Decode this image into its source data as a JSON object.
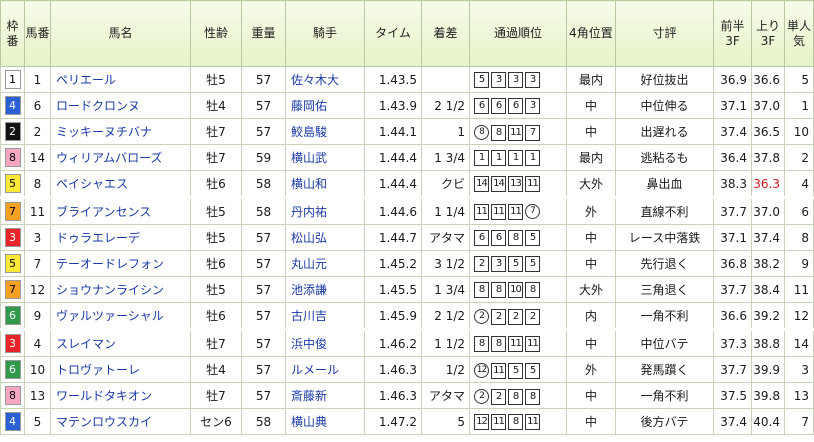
{
  "headers": {
    "waku": "枠番",
    "umaban": "馬番",
    "name": "馬名",
    "sexage": "性齢",
    "weight": "重量",
    "jockey": "騎手",
    "time": "タイム",
    "margin": "着差",
    "passing": "通過順位",
    "corner": "4角位置",
    "comment": "寸評",
    "first3f": "前半3F",
    "last3f": "上り3F",
    "odds": "単人気"
  },
  "waku_colors": {
    "1": {
      "bg": "#ffffff",
      "fg": "#000000"
    },
    "2": {
      "bg": "#111111",
      "fg": "#ffffff"
    },
    "3": {
      "bg": "#e8262a",
      "fg": "#ffffff"
    },
    "4": {
      "bg": "#2a5fd6",
      "fg": "#ffffff"
    },
    "5": {
      "bg": "#ffe838",
      "fg": "#000000"
    },
    "6": {
      "bg": "#2e9a4a",
      "fg": "#ffffff"
    },
    "7": {
      "bg": "#f5a023",
      "fg": "#000000"
    },
    "8": {
      "bg": "#f7a7c4",
      "fg": "#000000"
    }
  },
  "rows": [
    {
      "waku": "1",
      "umaban": "1",
      "name": "ペリエール",
      "sexage": "牡5",
      "weight": "57",
      "jockey": "佐々木大",
      "time": "1.43.5",
      "margin": "",
      "passing": [
        {
          "v": "5",
          "s": "box"
        },
        {
          "v": "3",
          "s": "box"
        },
        {
          "v": "3",
          "s": "box"
        },
        {
          "v": "3",
          "s": "box"
        }
      ],
      "corner": "最内",
      "comment": "好位抜出",
      "f3": "36.9",
      "l3": "36.6",
      "odds": "5",
      "l3_red": false
    },
    {
      "waku": "4",
      "umaban": "6",
      "name": "ロードクロンヌ",
      "sexage": "牡4",
      "weight": "57",
      "jockey": "藤岡佑",
      "time": "1.43.9",
      "margin": "2 1/2",
      "passing": [
        {
          "v": "6",
          "s": "box"
        },
        {
          "v": "6",
          "s": "box"
        },
        {
          "v": "6",
          "s": "box"
        },
        {
          "v": "3",
          "s": "box"
        }
      ],
      "corner": "中",
      "comment": "中位伸る",
      "f3": "37.1",
      "l3": "37.0",
      "odds": "1",
      "l3_red": false
    },
    {
      "waku": "2",
      "umaban": "2",
      "name": "ミッキーヌチバナ",
      "sexage": "牡7",
      "weight": "57",
      "jockey": "鮫島駿",
      "time": "1.44.1",
      "margin": "1",
      "passing": [
        {
          "v": "8",
          "s": "circ"
        },
        {
          "v": "8",
          "s": "box"
        },
        {
          "v": "11",
          "s": "box"
        },
        {
          "v": "7",
          "s": "box"
        }
      ],
      "corner": "中",
      "comment": "出遅れる",
      "f3": "37.4",
      "l3": "36.5",
      "odds": "10",
      "l3_red": false
    },
    {
      "waku": "8",
      "umaban": "14",
      "name": "ウィリアムバローズ",
      "sexage": "牡7",
      "weight": "59",
      "jockey": "横山武",
      "time": "1.44.4",
      "margin": "1 3/4",
      "passing": [
        {
          "v": "1",
          "s": "box"
        },
        {
          "v": "1",
          "s": "box"
        },
        {
          "v": "1",
          "s": "box"
        },
        {
          "v": "1",
          "s": "box"
        }
      ],
      "corner": "最内",
      "comment": "逃粘るも",
      "f3": "36.4",
      "l3": "37.8",
      "odds": "2",
      "l3_red": false
    },
    {
      "waku": "5",
      "umaban": "8",
      "name": "ペイシャエス",
      "sexage": "牡6",
      "weight": "58",
      "jockey": "横山和",
      "time": "1.44.4",
      "margin": "クビ",
      "passing": [
        {
          "v": "14",
          "s": "box"
        },
        {
          "v": "14",
          "s": "box"
        },
        {
          "v": "13",
          "s": "box"
        },
        {
          "v": "11",
          "s": "box"
        }
      ],
      "corner": "大外",
      "comment": "鼻出血",
      "f3": "38.3",
      "l3": "36.3",
      "odds": "4",
      "l3_red": true
    },
    {
      "waku": "7",
      "umaban": "11",
      "name": "ブライアンセンス",
      "sexage": "牡5",
      "weight": "58",
      "jockey": "丹内祐",
      "time": "1.44.6",
      "margin": "1 1/4",
      "passing": [
        {
          "v": "11",
          "s": "box"
        },
        {
          "v": "11",
          "s": "box"
        },
        {
          "v": "11",
          "s": "box"
        },
        {
          "v": "7",
          "s": "circ"
        }
      ],
      "corner": "外",
      "comment": "直線不利",
      "f3": "37.7",
      "l3": "37.0",
      "odds": "6",
      "l3_red": false,
      "sep": true
    },
    {
      "waku": "3",
      "umaban": "3",
      "name": "ドゥラエレーデ",
      "sexage": "牡5",
      "weight": "57",
      "jockey": "松山弘",
      "time": "1.44.7",
      "margin": "アタマ",
      "passing": [
        {
          "v": "6",
          "s": "box"
        },
        {
          "v": "6",
          "s": "box"
        },
        {
          "v": "8",
          "s": "box"
        },
        {
          "v": "5",
          "s": "box"
        }
      ],
      "corner": "中",
      "comment": "レース中落鉄",
      "f3": "37.1",
      "l3": "37.4",
      "odds": "8",
      "l3_red": false
    },
    {
      "waku": "5",
      "umaban": "7",
      "name": "テーオードレフォン",
      "sexage": "牡6",
      "weight": "57",
      "jockey": "丸山元",
      "time": "1.45.2",
      "margin": "3 1/2",
      "passing": [
        {
          "v": "2",
          "s": "box"
        },
        {
          "v": "3",
          "s": "box"
        },
        {
          "v": "5",
          "s": "box"
        },
        {
          "v": "5",
          "s": "box"
        }
      ],
      "corner": "中",
      "comment": "先行退く",
      "f3": "36.8",
      "l3": "38.2",
      "odds": "9",
      "l3_red": false
    },
    {
      "waku": "7",
      "umaban": "12",
      "name": "ショウナンライシン",
      "sexage": "牡5",
      "weight": "57",
      "jockey": "池添謙",
      "time": "1.45.5",
      "margin": "1 3/4",
      "passing": [
        {
          "v": "8",
          "s": "box"
        },
        {
          "v": "8",
          "s": "box"
        },
        {
          "v": "10",
          "s": "box"
        },
        {
          "v": "8",
          "s": "box"
        }
      ],
      "corner": "大外",
      "comment": "三角退く",
      "f3": "37.7",
      "l3": "38.4",
      "odds": "11",
      "l3_red": false
    },
    {
      "waku": "6",
      "umaban": "9",
      "name": "ヴァルツァーシャル",
      "sexage": "牡6",
      "weight": "57",
      "jockey": "古川吉",
      "time": "1.45.9",
      "margin": "2 1/2",
      "passing": [
        {
          "v": "2",
          "s": "circ"
        },
        {
          "v": "2",
          "s": "box"
        },
        {
          "v": "2",
          "s": "box"
        },
        {
          "v": "2",
          "s": "box"
        }
      ],
      "corner": "内",
      "comment": "一角不利",
      "f3": "36.6",
      "l3": "39.2",
      "odds": "12",
      "l3_red": false
    },
    {
      "waku": "3",
      "umaban": "4",
      "name": "スレイマン",
      "sexage": "牡7",
      "weight": "57",
      "jockey": "浜中俊",
      "time": "1.46.2",
      "margin": "1 1/2",
      "passing": [
        {
          "v": "8",
          "s": "box"
        },
        {
          "v": "8",
          "s": "box"
        },
        {
          "v": "11",
          "s": "box"
        },
        {
          "v": "11",
          "s": "box"
        }
      ],
      "corner": "中",
      "comment": "中位バテ",
      "f3": "37.3",
      "l3": "38.8",
      "odds": "14",
      "l3_red": false,
      "sep": true
    },
    {
      "waku": "6",
      "umaban": "10",
      "name": "トロヴァトーレ",
      "sexage": "牡4",
      "weight": "57",
      "jockey": "ルメール",
      "time": "1.46.3",
      "margin": "1/2",
      "passing": [
        {
          "v": "12",
          "s": "circ"
        },
        {
          "v": "11",
          "s": "box"
        },
        {
          "v": "5",
          "s": "box"
        },
        {
          "v": "5",
          "s": "box"
        }
      ],
      "corner": "外",
      "comment": "発馬躓く",
      "f3": "37.7",
      "l3": "39.9",
      "odds": "3",
      "l3_red": false
    },
    {
      "waku": "8",
      "umaban": "13",
      "name": "ワールドタキオン",
      "sexage": "牡7",
      "weight": "57",
      "jockey": "斎藤新",
      "time": "1.46.3",
      "margin": "アタマ",
      "passing": [
        {
          "v": "2",
          "s": "circ"
        },
        {
          "v": "2",
          "s": "box"
        },
        {
          "v": "8",
          "s": "box"
        },
        {
          "v": "8",
          "s": "box"
        }
      ],
      "corner": "中",
      "comment": "一角不利",
      "f3": "37.5",
      "l3": "39.8",
      "odds": "13",
      "l3_red": false
    },
    {
      "waku": "4",
      "umaban": "5",
      "name": "マテンロウスカイ",
      "sexage": "セン6",
      "weight": "58",
      "jockey": "横山典",
      "time": "1.47.2",
      "margin": "5",
      "passing": [
        {
          "v": "12",
          "s": "box"
        },
        {
          "v": "11",
          "s": "box"
        },
        {
          "v": "8",
          "s": "box"
        },
        {
          "v": "11",
          "s": "box"
        }
      ],
      "corner": "中",
      "comment": "後方バテ",
      "f3": "37.4",
      "l3": "40.4",
      "odds": "7",
      "l3_red": false
    }
  ]
}
